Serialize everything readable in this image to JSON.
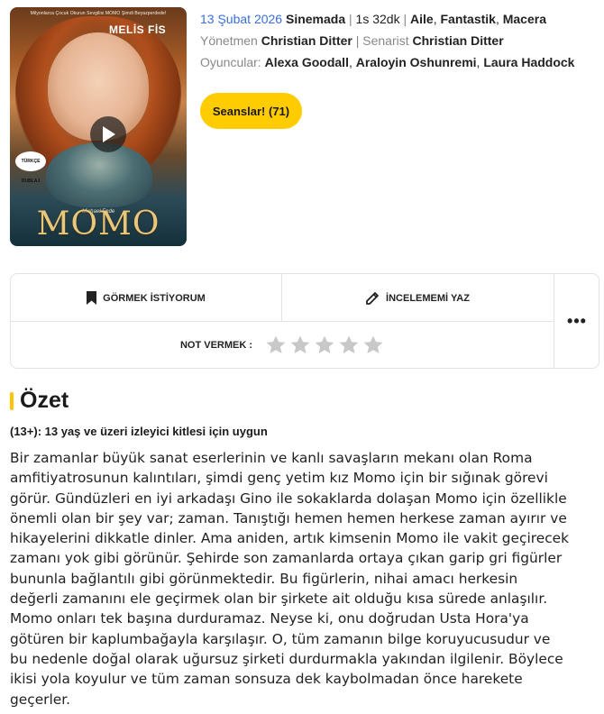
{
  "poster": {
    "top_text": "Milyonlarca Çocuk Okurun Sevgilisi MOMO Şimdi Beyazperdede!",
    "actor": "MELİS FİS",
    "badge": "TÜRKÇE DUBLAJ",
    "title": "MOMO",
    "signature": "Michael Ende"
  },
  "movie": {
    "date": "13 Şubat 2026",
    "status": "Sinemada",
    "duration": "1s 32dk",
    "genres": [
      "Aile",
      "Fantastik",
      "Macera"
    ],
    "director_label": "Yönetmen",
    "director": "Christian Ditter",
    "writer_label": "Senarist",
    "writer": "Christian Ditter",
    "cast_label": "Oyuncular:",
    "cast": [
      "Alexa Goodall",
      "Araloyin Oshunremi",
      "Laura Haddock"
    ]
  },
  "seans_button": "Seanslar! (71)",
  "actions": {
    "watchlist": "GÖRMEK İSTİYORUM",
    "review": "İNCELEMEMİ YAZ",
    "more": "•••",
    "rate_label": "NOT VERMEK :",
    "stars_count": 5
  },
  "summary": {
    "heading": "Özet",
    "age_rating": "(13+): 13 yaş ve üzeri izleyici kitlesi için uygun",
    "plot_lines": [
      "Bir zamanlar büyük sanat eserlerinin ve kanlı savaşların mekanı olan Roma",
      "amfitiyatrosunun kalıntıları, şimdi genç yetim kız Momo için bir sığınak görevi",
      "görür. Gündüzleri en iyi arkadaşı Gino ile sokaklarda dolaşan Momo için özellikle",
      "önemli olan bir şey var; zaman. Tanıştığı hemen hemen herkese zaman ayırır ve",
      "hikayelerini dikkatle dinler. Ama aniden, artık kimsenin Momo ile vakit geçirecek",
      "zamanı yok gibi görünür. Şehirde son zamanlarda ortaya çıkan garip gri figürler",
      "bununla bağlantılı gibi görünmektedir. Bu figürlerin, nihai amacı herkesin",
      "değerli zamanını ele geçirmek olan bir şirkete ait olduğu kısa sürede anlaşılır.",
      "Momo onları tek başına durduramaz. Neyse ki, onu doğrudan Usta Hora'ya",
      "götüren bir kaplumbağayla karşılaşır. O, tüm zamanın bilge koruyucusudur ve",
      "bu nedenle doğal olarak uğursuz şirketi durdurmakla yakından ilgilenir. Böylece",
      "ikisi yola koyulur ve tüm zaman sonsuza dek kaybolmadan önce harekete",
      "geçerler."
    ]
  },
  "colors": {
    "accent_yellow": "#ffcc00",
    "date_blue": "#3a6fd8",
    "muted_gray": "#888888",
    "star_gray": "#c8c8c8"
  }
}
